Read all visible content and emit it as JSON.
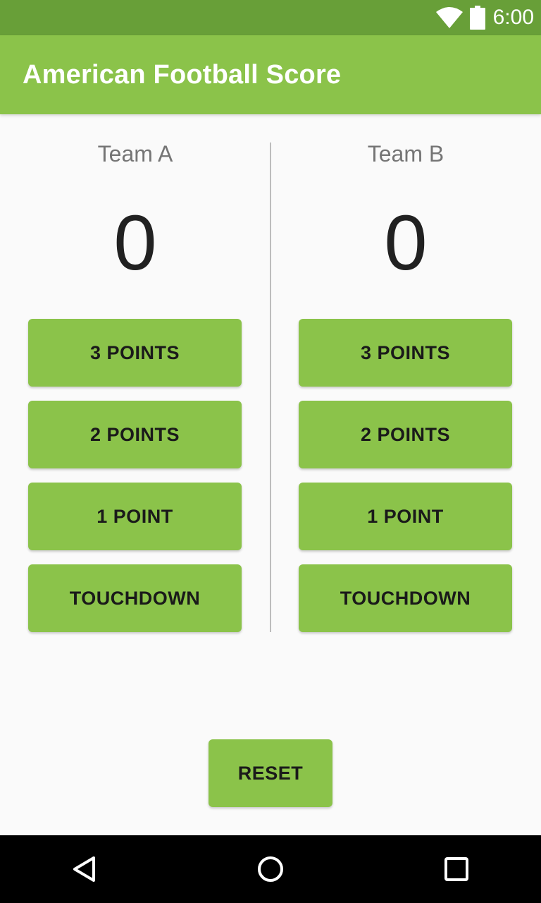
{
  "status_bar": {
    "time": "6:00",
    "wifi_icon": "wifi-icon",
    "battery_icon": "battery-icon",
    "color": "#689f38"
  },
  "app_bar": {
    "title": "American Football Score",
    "color": "#8bc34a"
  },
  "team_a": {
    "name": "Team A",
    "score": "0",
    "buttons": [
      "3 POINTS",
      "2 POINTS",
      "1 POINT",
      "TOUCHDOWN"
    ]
  },
  "team_b": {
    "name": "Team B",
    "score": "0",
    "buttons": [
      "3 POINTS",
      "2 POINTS",
      "1 POINT",
      "TOUCHDOWN"
    ]
  },
  "reset_label": "RESET",
  "nav_bar": {
    "back_icon": "back-triangle-icon",
    "home_icon": "home-circle-icon",
    "recents_icon": "recents-square-icon"
  }
}
